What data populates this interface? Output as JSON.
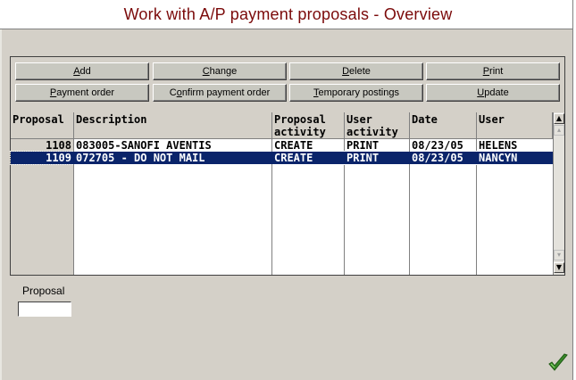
{
  "window": {
    "title": "Work with A/P payment proposals - Overview"
  },
  "toolbar": {
    "buttons": [
      {
        "label": "Add",
        "accel": "A"
      },
      {
        "label": "Change",
        "accel": "C"
      },
      {
        "label": "Delete",
        "accel": "D"
      },
      {
        "label": "Print",
        "accel": "P"
      },
      {
        "label": "Payment order",
        "accel": "P"
      },
      {
        "label": "Confirm payment order",
        "accel": "o"
      },
      {
        "label": "Temporary postings",
        "accel": "T"
      },
      {
        "label": "Update",
        "accel": "U"
      }
    ]
  },
  "grid": {
    "columns": [
      {
        "key": "proposal",
        "label": "Proposal"
      },
      {
        "key": "description",
        "label": "Description"
      },
      {
        "key": "proposal_activity",
        "label": "Proposal\nactivity"
      },
      {
        "key": "user_activity",
        "label": "User\nactivity"
      },
      {
        "key": "date",
        "label": "Date"
      },
      {
        "key": "user",
        "label": "User"
      }
    ],
    "rows": [
      {
        "proposal": "1108",
        "description": "083005-SANOFI AVENTIS",
        "proposal_activity": "CREATE",
        "user_activity": "PRINT",
        "date": "08/23/05",
        "user": "HELENS",
        "selected": false
      },
      {
        "proposal": "1109",
        "description": "072705 - DO NOT MAIL",
        "proposal_activity": "CREATE",
        "user_activity": "PRINT",
        "date": "08/23/05",
        "user": "NANCYN",
        "selected": true
      }
    ]
  },
  "filter": {
    "label": "Proposal",
    "value": ""
  },
  "icons": {
    "confirm": "checkmark-icon",
    "scroll_top": "scroll-top-icon",
    "scroll_up": "scroll-up-icon",
    "scroll_down": "scroll-down-icon",
    "scroll_bottom": "scroll-bottom-icon"
  },
  "colors": {
    "title_text": "#7b0a0a",
    "selection": "#0a246a",
    "checkmark": "#3a8a2a"
  }
}
